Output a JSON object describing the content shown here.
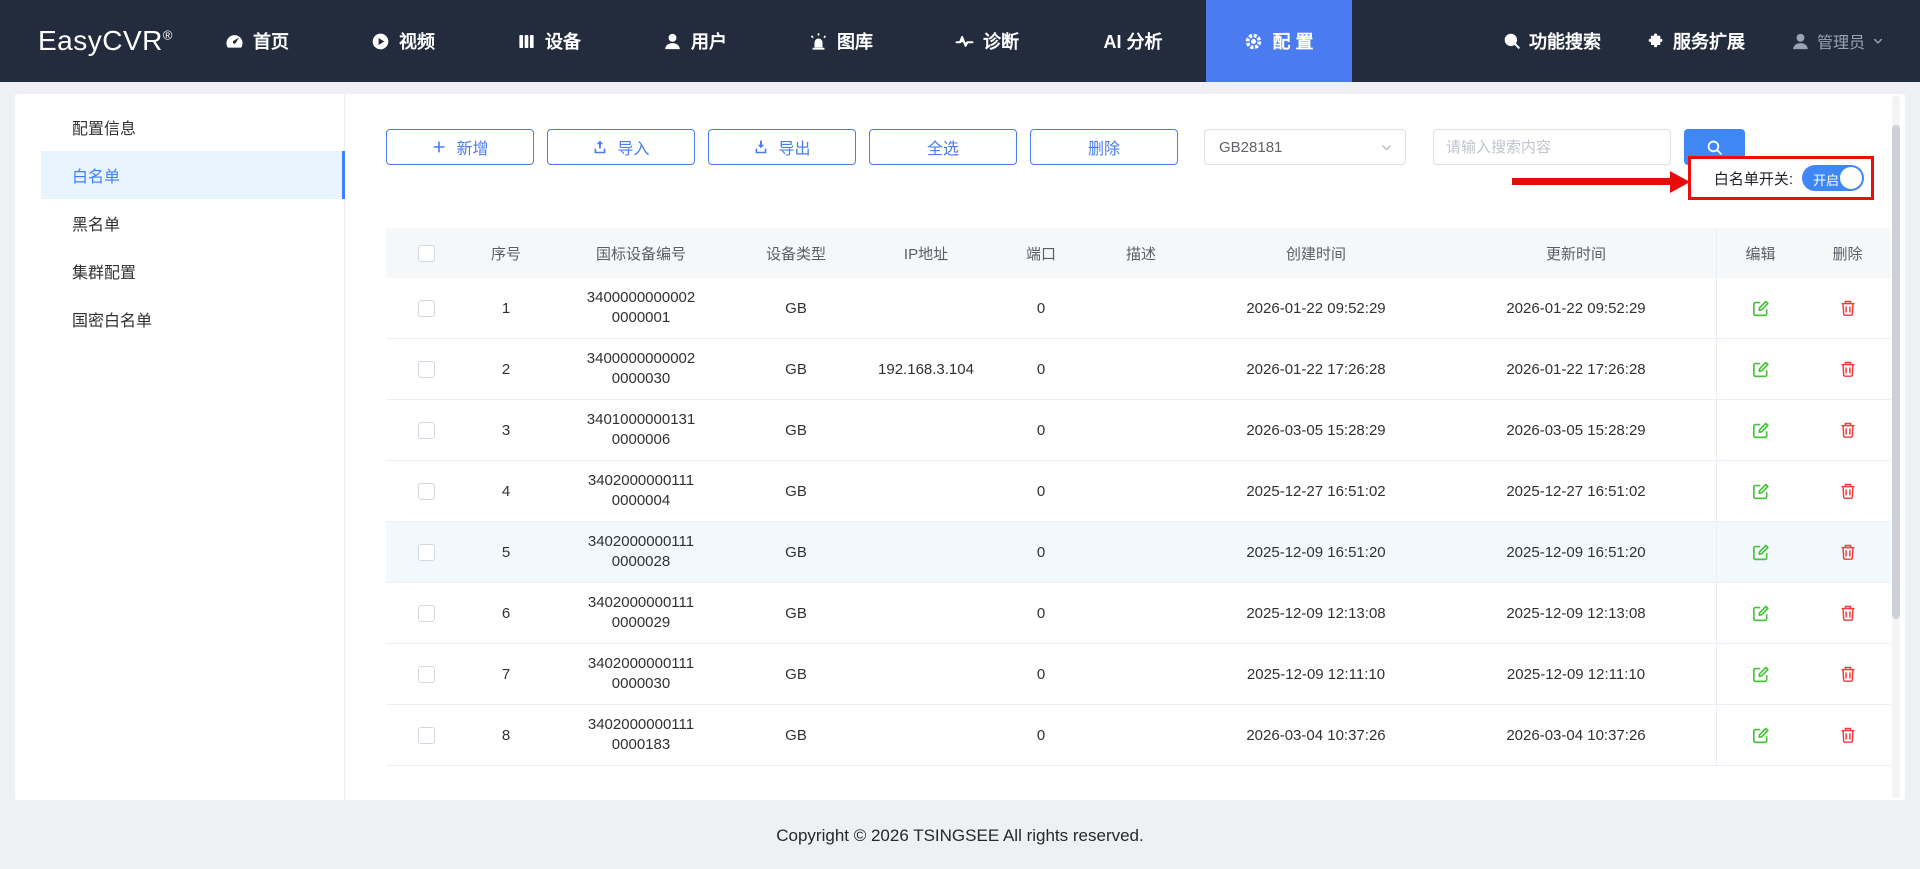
{
  "navbar": {
    "logo": "EasyCVR",
    "logo_sup": "®",
    "items": [
      {
        "key": "home",
        "label": "首页",
        "icon": "dashboard",
        "active": false
      },
      {
        "key": "video",
        "label": "视频",
        "icon": "video",
        "active": false
      },
      {
        "key": "device",
        "label": "设备",
        "icon": "device",
        "active": false
      },
      {
        "key": "user",
        "label": "用户",
        "icon": "user",
        "active": false
      },
      {
        "key": "gallery",
        "label": "图库",
        "icon": "gallery",
        "active": false
      },
      {
        "key": "diagnosis",
        "label": "诊断",
        "icon": "diagnosis",
        "active": false
      },
      {
        "key": "ai-analysis",
        "label": "AI 分析",
        "icon": "",
        "active": false
      },
      {
        "key": "config",
        "label": "配 置",
        "icon": "gear",
        "active": true
      }
    ],
    "right_links": [
      {
        "key": "feature-search",
        "label": "功能搜索",
        "icon": "search"
      },
      {
        "key": "service-extend",
        "label": "服务扩展",
        "icon": "puzzle"
      }
    ],
    "user": {
      "label": "管理员",
      "icon": "person",
      "chevron_icon": "chevron-down"
    }
  },
  "sidebar": {
    "items": [
      {
        "label": "配置信息",
        "active": false
      },
      {
        "label": "白名单",
        "active": true
      },
      {
        "label": "黑名单",
        "active": false
      },
      {
        "label": "集群配置",
        "active": false
      },
      {
        "label": "国密白名单",
        "active": false
      }
    ]
  },
  "toolbar": {
    "buttons": [
      {
        "key": "add",
        "label": "新增",
        "icon": "plus"
      },
      {
        "key": "import",
        "label": "导入",
        "icon": "upload"
      },
      {
        "key": "export",
        "label": "导出",
        "icon": "download"
      },
      {
        "key": "select-all",
        "label": "全选",
        "icon": ""
      },
      {
        "key": "delete",
        "label": "删除",
        "icon": ""
      }
    ],
    "protocol_select": {
      "value": "GB28181"
    },
    "search": {
      "placeholder": "请输入搜索内容"
    },
    "whitelist_switch": {
      "label": "白名单开关:",
      "state_label": "开启",
      "on": true
    }
  },
  "table": {
    "headers": [
      "",
      "序号",
      "国标设备编号",
      "设备类型",
      "IP地址",
      "端口",
      "描述",
      "创建时间",
      "更新时间",
      "编辑",
      "删除"
    ],
    "rows": [
      {
        "index": "1",
        "device_id_line1": "3400000000002",
        "device_id_line2": "0000001",
        "type": "GB",
        "ip": "",
        "port": "0",
        "desc": "",
        "created": "2026-01-22 09:52:29",
        "updated": "2026-01-22 09:52:29",
        "highlight": false
      },
      {
        "index": "2",
        "device_id_line1": "3400000000002",
        "device_id_line2": "0000030",
        "type": "GB",
        "ip": "192.168.3.104",
        "port": "0",
        "desc": "",
        "created": "2026-01-22 17:26:28",
        "updated": "2026-01-22 17:26:28",
        "highlight": false
      },
      {
        "index": "3",
        "device_id_line1": "3401000000131",
        "device_id_line2": "0000006",
        "type": "GB",
        "ip": "",
        "port": "0",
        "desc": "",
        "created": "2026-03-05 15:28:29",
        "updated": "2026-03-05 15:28:29",
        "highlight": false
      },
      {
        "index": "4",
        "device_id_line1": "3402000000111",
        "device_id_line2": "0000004",
        "type": "GB",
        "ip": "",
        "port": "0",
        "desc": "",
        "created": "2025-12-27 16:51:02",
        "updated": "2025-12-27 16:51:02",
        "highlight": false
      },
      {
        "index": "5",
        "device_id_line1": "3402000000111",
        "device_id_line2": "0000028",
        "type": "GB",
        "ip": "",
        "port": "0",
        "desc": "",
        "created": "2025-12-09 16:51:20",
        "updated": "2025-12-09 16:51:20",
        "highlight": true
      },
      {
        "index": "6",
        "device_id_line1": "3402000000111",
        "device_id_line2": "0000029",
        "type": "GB",
        "ip": "",
        "port": "0",
        "desc": "",
        "created": "2025-12-09 12:13:08",
        "updated": "2025-12-09 12:13:08",
        "highlight": false
      },
      {
        "index": "7",
        "device_id_line1": "3402000000111",
        "device_id_line2": "0000030",
        "type": "GB",
        "ip": "",
        "port": "0",
        "desc": "",
        "created": "2025-12-09 12:11:10",
        "updated": "2025-12-09 12:11:10",
        "highlight": false
      },
      {
        "index": "8",
        "device_id_line1": "3402000000111",
        "device_id_line2": "0000183",
        "type": "GB",
        "ip": "",
        "port": "0",
        "desc": "",
        "created": "2026-03-04 10:37:26",
        "updated": "2026-03-04 10:37:26",
        "highlight": false
      }
    ]
  },
  "footer": {
    "copyright": "Copyright © 2026 TSINGSEE All rights reserved."
  },
  "colors": {
    "navbar_bg": "#232c3d",
    "nav_active_blue": "#4a7bf0",
    "button_blue": "#4a7bf0",
    "search_button_blue": "#3f87f5",
    "toggle_blue": "#3f87f5",
    "sidebar_active_bg": "#e9f5fe",
    "sidebar_active_text": "#3d7fff",
    "annotation_red": "#ec0d0d",
    "edit_green": "#49c13b",
    "delete_red": "#f23c3c"
  }
}
